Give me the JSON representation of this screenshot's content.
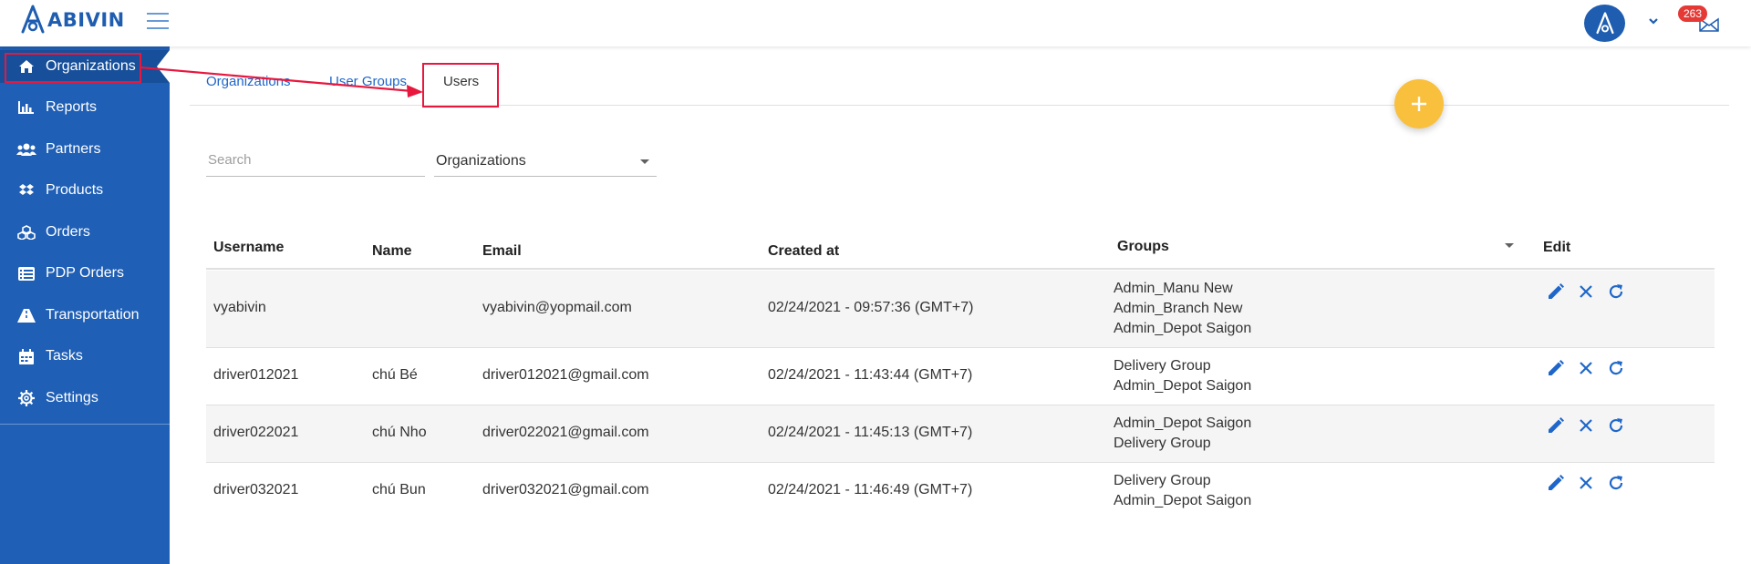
{
  "brand": {
    "name": "ABIVIN",
    "color": "#1e5db0"
  },
  "header": {
    "notification_count": "263"
  },
  "sidebar": {
    "items": [
      {
        "label": "Organizations",
        "icon": "home-icon"
      },
      {
        "label": "Reports",
        "icon": "bar-chart-icon"
      },
      {
        "label": "Partners",
        "icon": "users-icon"
      },
      {
        "label": "Products",
        "icon": "dropbox-icon"
      },
      {
        "label": "Orders",
        "icon": "cubes-icon"
      },
      {
        "label": "PDP Orders",
        "icon": "list-icon"
      },
      {
        "label": "Transportation",
        "icon": "road-icon"
      },
      {
        "label": "Tasks",
        "icon": "calendar-icon"
      },
      {
        "label": "Settings",
        "icon": "gear-icon"
      }
    ],
    "color": "#1f5fb5"
  },
  "tabs": [
    {
      "label": "Organizations"
    },
    {
      "label": "User Groups"
    },
    {
      "label": "Users"
    }
  ],
  "filters": {
    "search_placeholder": "Search",
    "select_value": "Organizations"
  },
  "table": {
    "columns": [
      "Username",
      "Name",
      "Email",
      "Created at",
      "Groups",
      "Edit"
    ],
    "rows": [
      {
        "username": "vyabivin",
        "name": "",
        "email": "vyabivin@yopmail.com",
        "created": "02/24/2021 - 09:57:36 (GMT+7)",
        "groups": [
          "Admin_Manu New",
          "Admin_Branch New",
          "Admin_Depot Saigon"
        ]
      },
      {
        "username": "driver012021",
        "name": "chú Bé",
        "email": "driver012021@gmail.com",
        "created": "02/24/2021 - 11:43:44 (GMT+7)",
        "groups": [
          "Delivery Group",
          "Admin_Depot Saigon"
        ]
      },
      {
        "username": "driver022021",
        "name": "chú Nho",
        "email": "driver022021@gmail.com",
        "created": "02/24/2021 - 11:45:13 (GMT+7)",
        "groups": [
          "Admin_Depot Saigon",
          "Delivery Group"
        ]
      },
      {
        "username": "driver032021",
        "name": "chú Bun",
        "email": "driver032021@gmail.com",
        "created": "02/24/2021 - 11:46:49 (GMT+7)",
        "groups": [
          "Delivery Group",
          "Admin_Depot Saigon"
        ]
      }
    ]
  },
  "colors": {
    "accent": "#1e66c9",
    "fab": "#f9c03d",
    "annotation": "#e8173e"
  }
}
